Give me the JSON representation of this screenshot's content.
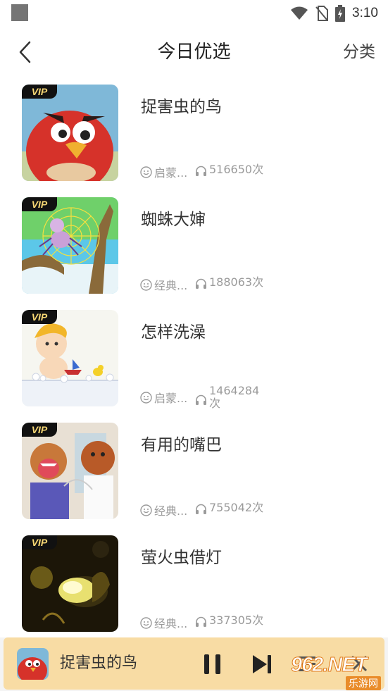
{
  "status_bar": {
    "time": "3:10"
  },
  "header": {
    "title": "今日优选",
    "right_label": "分类"
  },
  "items": [
    {
      "title": "捉害虫的鸟",
      "badge": "VIP",
      "category": "启蒙...",
      "plays": "516650次",
      "thumb_icon": "red-bird-image"
    },
    {
      "title": "蜘蛛大婶",
      "badge": "VIP",
      "category": "经典...",
      "plays": "188063次",
      "thumb_icon": "spider-web-image"
    },
    {
      "title": "怎样洗澡",
      "badge": "VIP",
      "category": "启蒙...",
      "plays": "1464284次",
      "thumb_icon": "bath-baby-image"
    },
    {
      "title": "有用的嘴巴",
      "badge": "VIP",
      "category": "经典...",
      "plays": "755042次",
      "thumb_icon": "bears-image"
    },
    {
      "title": "萤火虫借灯",
      "badge": "VIP",
      "category": "经典...",
      "plays": "337305次",
      "thumb_icon": "firefly-image"
    }
  ],
  "player": {
    "title": "捉害虫的鸟"
  },
  "watermark": {
    "main": "962.NET",
    "sub": "乐游网"
  },
  "colors": {
    "player_bg": "#f8dca4",
    "vip_text": "#f7d774",
    "vip_bg": "#111111"
  }
}
